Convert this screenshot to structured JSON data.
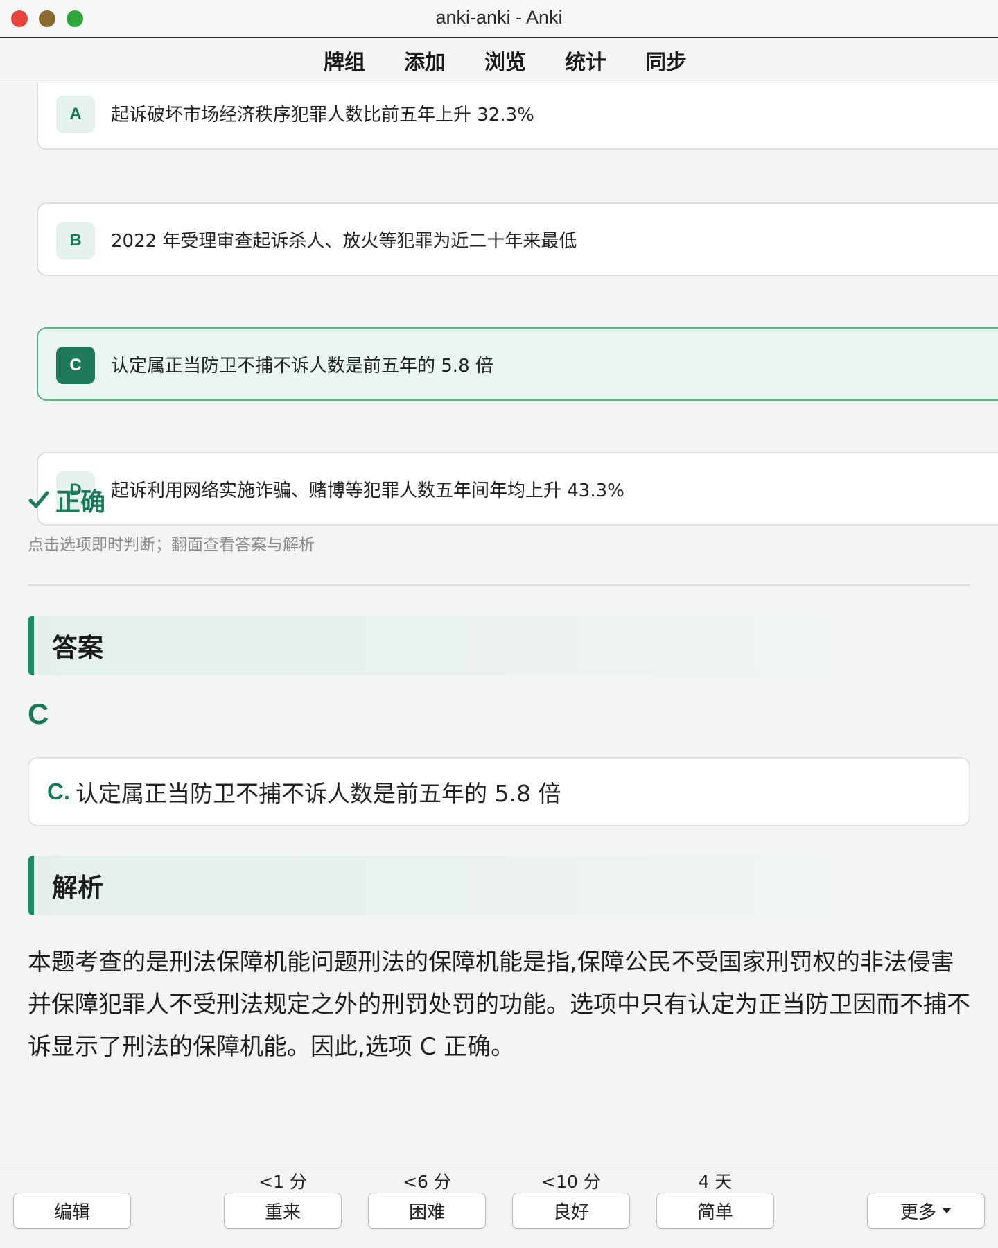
{
  "window": {
    "title": "anki-anki - Anki"
  },
  "toolbar": {
    "items": [
      "牌组",
      "添加",
      "浏览",
      "统计",
      "同步"
    ]
  },
  "options": [
    {
      "letter": "A",
      "text": "起诉破坏市场经济秩序犯罪人数比前五年上升 32.3%"
    },
    {
      "letter": "B",
      "text": "2022 年受理审查起诉杀人、放火等犯罪为近二十年来最低"
    },
    {
      "letter": "C",
      "text": "认定属正当防卫不捕不诉人数是前五年的 5.8 倍"
    },
    {
      "letter": "D",
      "text": "起诉利用网络实施诈骗、赌博等犯罪人数五年间年均上升 43.3%"
    }
  ],
  "result": {
    "label": "正确",
    "hint": "点击选项即时判断；翻面查看答案与解析"
  },
  "answer": {
    "heading": "答案",
    "letter": "C",
    "prefix": "C.",
    "text": "认定属正当防卫不捕不诉人数是前五年的 5.8 倍"
  },
  "analysis": {
    "heading": "解析",
    "text": "本题考查的是刑法保障机能问题刑法的保障机能是指,保障公民不受国家刑罚权的非法侵害并保障犯罪人不受刑法规定之外的刑罚处罚的功能。选项中只有认定为正当防卫因而不捕不诉显示了刑法的保障机能。因此,选项 C 正确。"
  },
  "bottom": {
    "edit": "编辑",
    "more": "更多",
    "ease": [
      {
        "interval": "<1 分",
        "label": "重来"
      },
      {
        "interval": "<6 分",
        "label": "困难"
      },
      {
        "interval": "<10 分",
        "label": "良好"
      },
      {
        "interval": "4 天",
        "label": "简单"
      }
    ]
  },
  "colors": {
    "accent": "#1a7a58",
    "selected_bg": "#eaf6f0"
  }
}
